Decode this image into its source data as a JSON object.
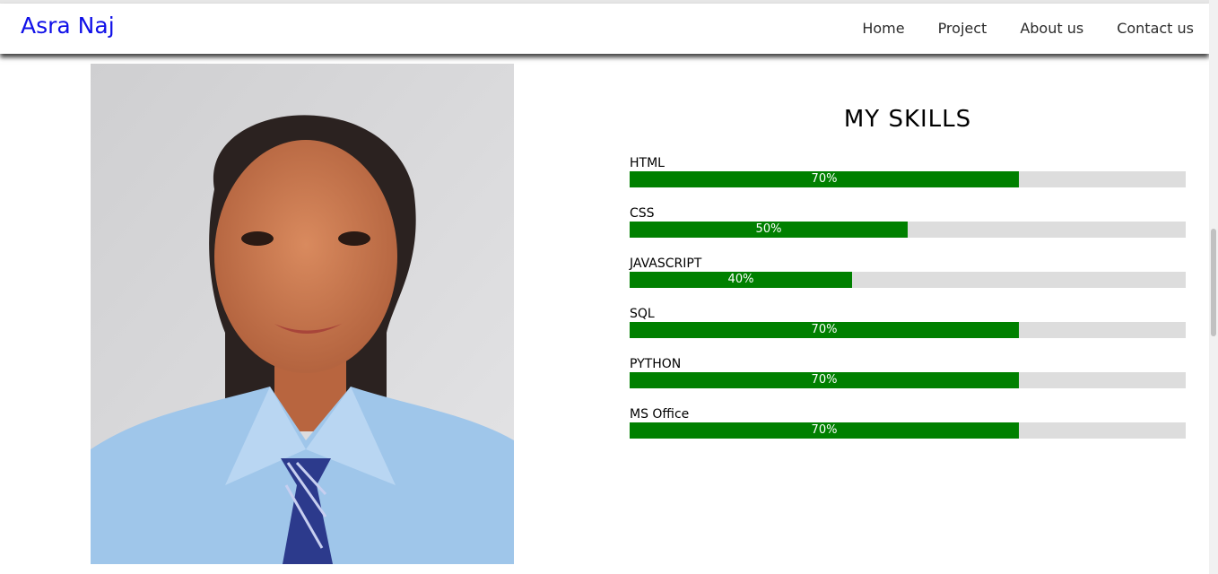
{
  "brand": "Asra Naj",
  "nav": [
    {
      "label": "Home"
    },
    {
      "label": "Project"
    },
    {
      "label": "About us"
    },
    {
      "label": "Contact us"
    }
  ],
  "skills": {
    "title": "MY SKILLS",
    "fill_color": "#008000",
    "track_color": "#dddddd",
    "items": [
      {
        "name": "HTML",
        "percent": 70,
        "label": "70%"
      },
      {
        "name": "CSS",
        "percent": 50,
        "label": "50%"
      },
      {
        "name": "JAVASCRIPT",
        "percent": 40,
        "label": "40%"
      },
      {
        "name": "SQL",
        "percent": 70,
        "label": "70%"
      },
      {
        "name": "PYTHON",
        "percent": 70,
        "label": "70%"
      },
      {
        "name": "MS Office",
        "percent": 70,
        "label": "70%"
      }
    ]
  },
  "brand_color": "#1010e8"
}
